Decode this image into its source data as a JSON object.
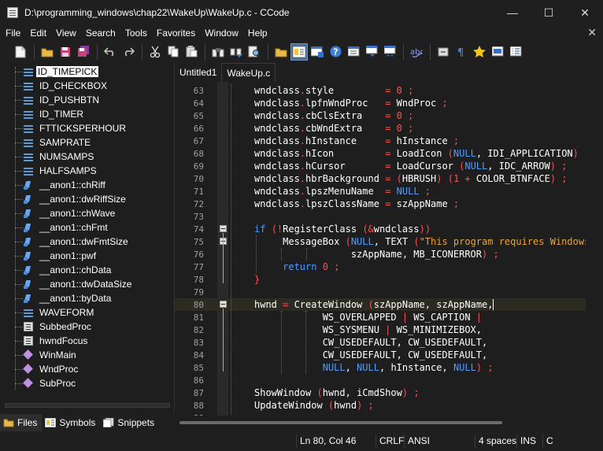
{
  "window": {
    "title": "D:\\programming_windows\\chap22\\WakeUp\\WakeUp.c - CCode",
    "minimize": "—",
    "maximize": "☐",
    "close": "✕"
  },
  "menu": {
    "items": [
      "File",
      "Edit",
      "View",
      "Search",
      "Tools",
      "Favorites",
      "Window",
      "Help"
    ],
    "close": "✕"
  },
  "toolbar": {
    "buttons": [
      "new-file",
      "open-file",
      "save",
      "save-all",
      "undo",
      "redo",
      "cut",
      "copy",
      "paste",
      "find",
      "find-next",
      "find-in-files",
      "open-folder",
      "symbols-panel",
      "output-panel",
      "help",
      "view-1",
      "view-2",
      "view-3",
      "spell-check",
      "toggle-1",
      "pilcrow",
      "favorite",
      "view-4",
      "view-5"
    ],
    "active": "symbols-panel"
  },
  "symbols": [
    {
      "label": "ID_TIMEPICK",
      "kind": "define",
      "selected": true
    },
    {
      "label": "ID_CHECKBOX",
      "kind": "define"
    },
    {
      "label": "ID_PUSHBTN",
      "kind": "define"
    },
    {
      "label": "ID_TIMER",
      "kind": "define"
    },
    {
      "label": "FTTICKSPERHOUR",
      "kind": "define"
    },
    {
      "label": "SAMPRATE",
      "kind": "define"
    },
    {
      "label": "NUMSAMPS",
      "kind": "define"
    },
    {
      "label": "HALFSAMPS",
      "kind": "define"
    },
    {
      "label": "__anon1::chRiff",
      "kind": "field"
    },
    {
      "label": "__anon1::dwRiffSize",
      "kind": "field"
    },
    {
      "label": "__anon1::chWave",
      "kind": "field"
    },
    {
      "label": "__anon1::chFmt",
      "kind": "field"
    },
    {
      "label": "__anon1::dwFmtSize",
      "kind": "field"
    },
    {
      "label": "__anon1::pwf",
      "kind": "field"
    },
    {
      "label": "__anon1::chData",
      "kind": "field"
    },
    {
      "label": "__anon1::dwDataSize",
      "kind": "field"
    },
    {
      "label": "__anon1::byData",
      "kind": "field"
    },
    {
      "label": "WAVEFORM",
      "kind": "define"
    },
    {
      "label": "SubbedProc",
      "kind": "struct"
    },
    {
      "label": "hwndFocus",
      "kind": "struct"
    },
    {
      "label": "WinMain",
      "kind": "func"
    },
    {
      "label": "WndProc",
      "kind": "func"
    },
    {
      "label": "SubProc",
      "kind": "func"
    }
  ],
  "panel_tabs": [
    {
      "label": "Files",
      "active": true
    },
    {
      "label": "Symbols",
      "active": false
    },
    {
      "label": "Snippets",
      "active": false
    }
  ],
  "editor_tabs": [
    {
      "label": "Untitled1",
      "active": false
    },
    {
      "label": "WakeUp.c",
      "active": true
    }
  ],
  "code_lines": [
    {
      "n": "63",
      "t": "wndclass.style         = 0 ;"
    },
    {
      "n": "64",
      "t": "wndclass.lpfnWndProc   = WndProc ;"
    },
    {
      "n": "65",
      "t": "wndclass.cbClsExtra    = 0 ;"
    },
    {
      "n": "66",
      "t": "wndclass.cbWndExtra    = 0 ;"
    },
    {
      "n": "67",
      "t": "wndclass.hInstance     = hInstance ;"
    },
    {
      "n": "68",
      "t": "wndclass.hIcon         = LoadIcon (NULL, IDI_APPLICATION) ;"
    },
    {
      "n": "69",
      "t": "wndclass.hCursor       = LoadCursor (NULL, IDC_ARROW) ;"
    },
    {
      "n": "70",
      "t": "wndclass.hbrBackground = (HBRUSH) (1 + COLOR_BTNFACE) ;"
    },
    {
      "n": "71",
      "t": "wndclass.lpszMenuName  = NULL ;"
    },
    {
      "n": "72",
      "t": "wndclass.lpszClassName = szAppName ;"
    },
    {
      "n": "73",
      "t": ""
    },
    {
      "n": "74",
      "t": "if (!RegisterClass (&wndclass))",
      "fold": true
    },
    {
      "n": "75",
      "t": "     MessageBox (NULL, TEXT (\"This program requires Windows NT!\"),",
      "fold": true
    },
    {
      "n": "76",
      "t": "                 szAppName, MB_ICONERROR) ;"
    },
    {
      "n": "77",
      "t": "     return 0 ;"
    },
    {
      "n": "78",
      "t": "}"
    },
    {
      "n": "79",
      "t": ""
    },
    {
      "n": "80",
      "t": "hwnd = CreateWindow (szAppName, szAppName,",
      "fold": true,
      "current": true
    },
    {
      "n": "81",
      "t": "            WS_OVERLAPPED | WS_CAPTION |"
    },
    {
      "n": "82",
      "t": "            WS_SYSMENU | WS_MINIMIZEBOX,"
    },
    {
      "n": "83",
      "t": "            CW_USEDEFAULT, CW_USEDEFAULT,"
    },
    {
      "n": "84",
      "t": "            CW_USEDEFAULT, CW_USEDEFAULT,"
    },
    {
      "n": "85",
      "t": "            NULL, NULL, hInstance, NULL) ;"
    },
    {
      "n": "86",
      "t": ""
    },
    {
      "n": "87",
      "t": "ShowWindow (hwnd, iCmdShow) ;"
    },
    {
      "n": "88",
      "t": "UpdateWindow (hwnd) ;"
    },
    {
      "n": "89",
      "t": ""
    }
  ],
  "status": {
    "position": "Ln 80, Col 46",
    "eol": "CRLF",
    "encoding": "ANSI",
    "indent": "4 spaces",
    "mode": "INS",
    "lang": "C"
  },
  "colors": {
    "background": "#1e1e1e",
    "chrome": "#1f1f1f",
    "current_line": "#2b2b22",
    "code_text": "#ffffff",
    "keyword": "#4f9bff",
    "string": "#e8a33c",
    "operator": "#ff5050",
    "number": "#ff5050",
    "selection": "#ffffff"
  }
}
